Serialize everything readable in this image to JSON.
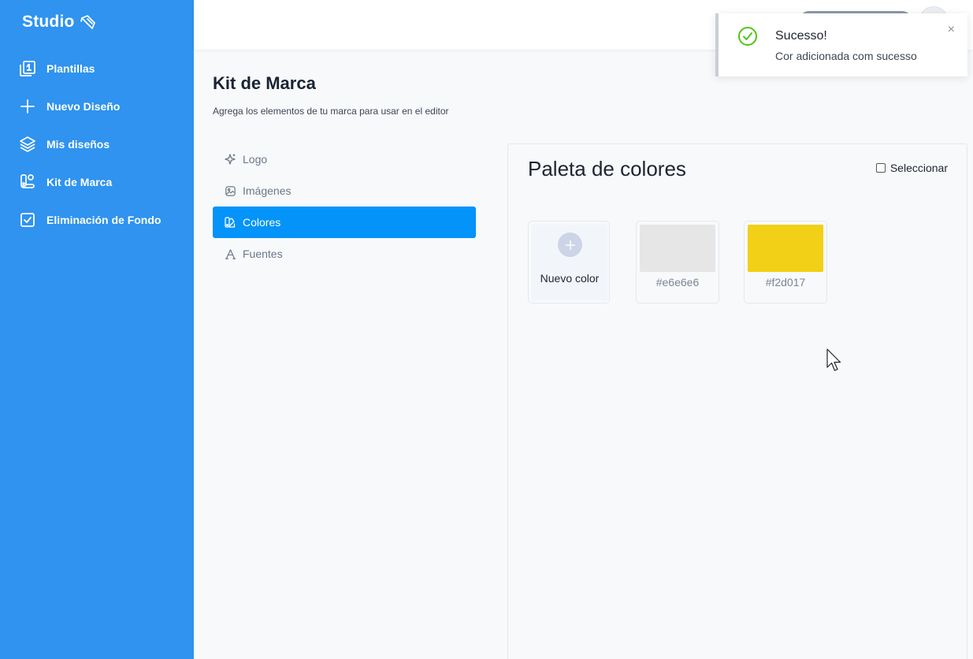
{
  "brand": {
    "name": "Studio",
    "icon": "brush-icon"
  },
  "sidebar": {
    "items": [
      {
        "label": "Plantillas",
        "icon": "templates-icon"
      },
      {
        "label": "Nuevo Diseño",
        "icon": "plus-icon"
      },
      {
        "label": "Mis diseños",
        "icon": "layers-icon"
      },
      {
        "label": "Kit de Marca",
        "icon": "brand-kit-icon"
      },
      {
        "label": "Eliminación de Fondo",
        "icon": "checkbox-icon"
      }
    ]
  },
  "page": {
    "title": "Kit de Marca",
    "subtitle": "Agrega los elementos de tu marca para usar en el editor"
  },
  "menu": {
    "items": [
      {
        "label": "Logo",
        "icon": "sparkle-icon",
        "active": false
      },
      {
        "label": "Imágenes",
        "icon": "image-icon",
        "active": false
      },
      {
        "label": "Colores",
        "icon": "palette-icon",
        "active": true
      },
      {
        "label": "Fuentes",
        "icon": "font-icon",
        "active": false
      }
    ]
  },
  "panel": {
    "title": "Paleta de colores",
    "select_label": "Seleccionar",
    "new_color_label": "Nuevo color",
    "colors": [
      {
        "hex": "#e6e6e6",
        "label": "#e6e6e6"
      },
      {
        "hex": "#f2d017",
        "label": "#f2d017"
      }
    ]
  },
  "toast": {
    "title": "Sucesso!",
    "message": "Cor adicionada com sucesso",
    "close": "×",
    "icon": "check-circle-icon",
    "accent": "#52c41a"
  },
  "colors": {
    "sidebar_bg": "#2f93ef",
    "active_menu": "#0393f9"
  }
}
